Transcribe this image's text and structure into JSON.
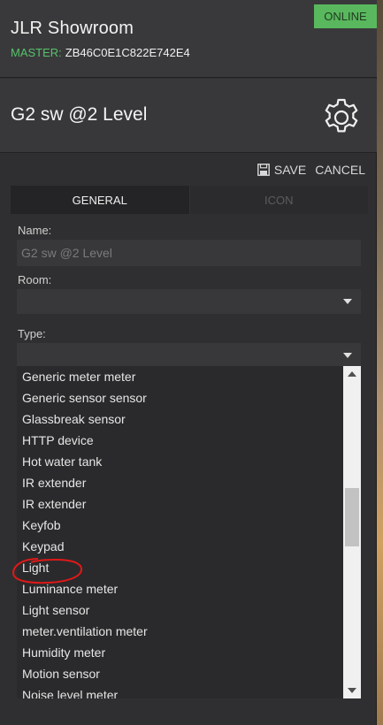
{
  "header": {
    "title": "JLR Showroom",
    "master_label": "MASTER:",
    "master_id": "ZB46C0E1C822E742E4",
    "status": "ONLINE"
  },
  "device": {
    "title": "G2 sw @2 Level",
    "settings_icon": "gear-icon"
  },
  "actions": {
    "save_label": "SAVE",
    "save_icon": "floppy-disk-icon",
    "cancel_label": "CANCEL"
  },
  "tabs": [
    {
      "label": "GENERAL",
      "active": true
    },
    {
      "label": "ICON",
      "active": false
    }
  ],
  "form": {
    "name_label": "Name:",
    "name_value": "G2 sw @2 Level",
    "room_label": "Room:",
    "room_value": "",
    "type_label": "Type:",
    "type_value": ""
  },
  "type_options": [
    "Generic meter meter",
    "Generic sensor sensor",
    "Glassbreak sensor",
    "HTTP device",
    "Hot water tank",
    "IR extender",
    "IR extender",
    "Keyfob",
    "Keypad",
    "Light",
    "Luminance meter",
    "Light sensor",
    "meter.ventilation meter",
    "Humidity meter",
    "Motion sensor",
    "Noise level meter"
  ],
  "colors": {
    "accent_green": "#59b85d",
    "master_green": "#55c26a",
    "annotation_red": "#e01818"
  }
}
